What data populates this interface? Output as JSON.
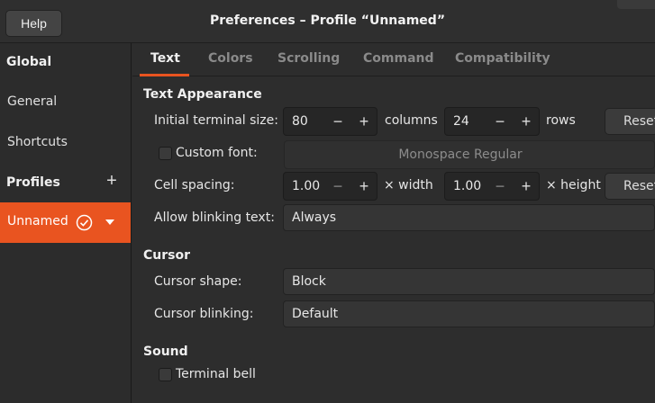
{
  "header": {
    "help_label": "Help",
    "title": "Preferences – Profile “Unnamed”"
  },
  "sidebar": {
    "global_heading": "Global",
    "items": [
      {
        "label": "General"
      },
      {
        "label": "Shortcuts"
      }
    ],
    "profiles_heading": "Profiles",
    "add_icon": "plus-icon",
    "profiles": [
      {
        "label": "Unnamed",
        "default": true,
        "selected": true
      }
    ]
  },
  "tabs": [
    {
      "label": "Text",
      "active": true
    },
    {
      "label": "Colors",
      "active": false
    },
    {
      "label": "Scrolling",
      "active": false
    },
    {
      "label": "Command",
      "active": false
    },
    {
      "label": "Compatibility",
      "active": false
    }
  ],
  "text_appearance": {
    "heading": "Text Appearance",
    "initial_size_label": "Initial terminal size:",
    "columns_value": "80",
    "columns_unit": "columns",
    "rows_value": "24",
    "rows_unit": "rows",
    "reset_label": "Reset",
    "custom_font_label": "Custom font:",
    "custom_font_checked": false,
    "font_value": "Monospace Regular",
    "cell_spacing_label": "Cell spacing:",
    "width_value": "1.00",
    "width_unit": "× width",
    "height_value": "1.00",
    "height_unit": "× height",
    "blink_label": "Allow blinking text:",
    "blink_value": "Always"
  },
  "cursor": {
    "heading": "Cursor",
    "shape_label": "Cursor shape:",
    "shape_value": "Block",
    "blinking_label": "Cursor blinking:",
    "blinking_value": "Default"
  },
  "sound": {
    "heading": "Sound",
    "bell_label": "Terminal bell",
    "bell_checked": false
  },
  "colors": {
    "accent": "#e95420",
    "background": "#2d2d2d"
  }
}
